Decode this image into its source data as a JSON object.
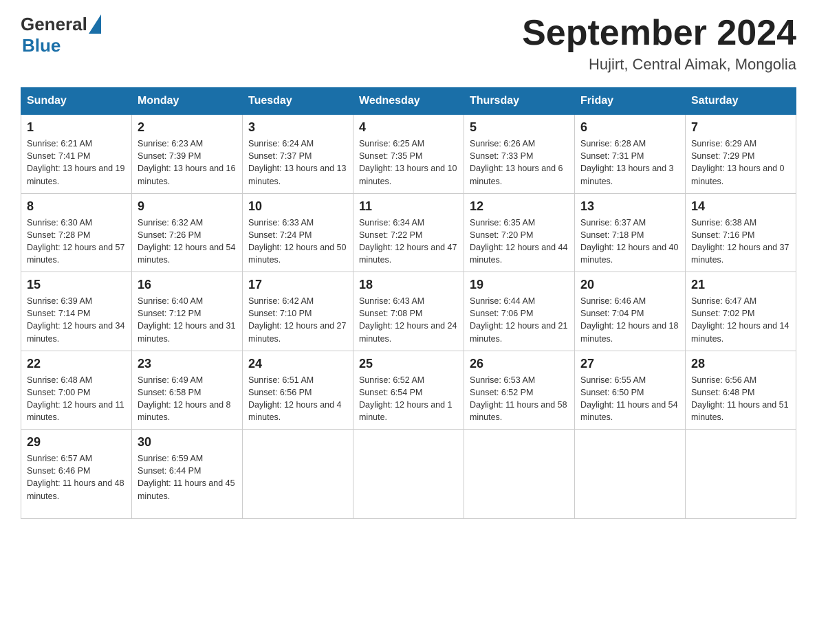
{
  "header": {
    "title": "September 2024",
    "location": "Hujirt, Central Aimak, Mongolia",
    "logo_general": "General",
    "logo_blue": "Blue"
  },
  "days_of_week": [
    "Sunday",
    "Monday",
    "Tuesday",
    "Wednesday",
    "Thursday",
    "Friday",
    "Saturday"
  ],
  "weeks": [
    [
      {
        "day": "1",
        "sunrise": "6:21 AM",
        "sunset": "7:41 PM",
        "daylight": "13 hours and 19 minutes."
      },
      {
        "day": "2",
        "sunrise": "6:23 AM",
        "sunset": "7:39 PM",
        "daylight": "13 hours and 16 minutes."
      },
      {
        "day": "3",
        "sunrise": "6:24 AM",
        "sunset": "7:37 PM",
        "daylight": "13 hours and 13 minutes."
      },
      {
        "day": "4",
        "sunrise": "6:25 AM",
        "sunset": "7:35 PM",
        "daylight": "13 hours and 10 minutes."
      },
      {
        "day": "5",
        "sunrise": "6:26 AM",
        "sunset": "7:33 PM",
        "daylight": "13 hours and 6 minutes."
      },
      {
        "day": "6",
        "sunrise": "6:28 AM",
        "sunset": "7:31 PM",
        "daylight": "13 hours and 3 minutes."
      },
      {
        "day": "7",
        "sunrise": "6:29 AM",
        "sunset": "7:29 PM",
        "daylight": "13 hours and 0 minutes."
      }
    ],
    [
      {
        "day": "8",
        "sunrise": "6:30 AM",
        "sunset": "7:28 PM",
        "daylight": "12 hours and 57 minutes."
      },
      {
        "day": "9",
        "sunrise": "6:32 AM",
        "sunset": "7:26 PM",
        "daylight": "12 hours and 54 minutes."
      },
      {
        "day": "10",
        "sunrise": "6:33 AM",
        "sunset": "7:24 PM",
        "daylight": "12 hours and 50 minutes."
      },
      {
        "day": "11",
        "sunrise": "6:34 AM",
        "sunset": "7:22 PM",
        "daylight": "12 hours and 47 minutes."
      },
      {
        "day": "12",
        "sunrise": "6:35 AM",
        "sunset": "7:20 PM",
        "daylight": "12 hours and 44 minutes."
      },
      {
        "day": "13",
        "sunrise": "6:37 AM",
        "sunset": "7:18 PM",
        "daylight": "12 hours and 40 minutes."
      },
      {
        "day": "14",
        "sunrise": "6:38 AM",
        "sunset": "7:16 PM",
        "daylight": "12 hours and 37 minutes."
      }
    ],
    [
      {
        "day": "15",
        "sunrise": "6:39 AM",
        "sunset": "7:14 PM",
        "daylight": "12 hours and 34 minutes."
      },
      {
        "day": "16",
        "sunrise": "6:40 AM",
        "sunset": "7:12 PM",
        "daylight": "12 hours and 31 minutes."
      },
      {
        "day": "17",
        "sunrise": "6:42 AM",
        "sunset": "7:10 PM",
        "daylight": "12 hours and 27 minutes."
      },
      {
        "day": "18",
        "sunrise": "6:43 AM",
        "sunset": "7:08 PM",
        "daylight": "12 hours and 24 minutes."
      },
      {
        "day": "19",
        "sunrise": "6:44 AM",
        "sunset": "7:06 PM",
        "daylight": "12 hours and 21 minutes."
      },
      {
        "day": "20",
        "sunrise": "6:46 AM",
        "sunset": "7:04 PM",
        "daylight": "12 hours and 18 minutes."
      },
      {
        "day": "21",
        "sunrise": "6:47 AM",
        "sunset": "7:02 PM",
        "daylight": "12 hours and 14 minutes."
      }
    ],
    [
      {
        "day": "22",
        "sunrise": "6:48 AM",
        "sunset": "7:00 PM",
        "daylight": "12 hours and 11 minutes."
      },
      {
        "day": "23",
        "sunrise": "6:49 AM",
        "sunset": "6:58 PM",
        "daylight": "12 hours and 8 minutes."
      },
      {
        "day": "24",
        "sunrise": "6:51 AM",
        "sunset": "6:56 PM",
        "daylight": "12 hours and 4 minutes."
      },
      {
        "day": "25",
        "sunrise": "6:52 AM",
        "sunset": "6:54 PM",
        "daylight": "12 hours and 1 minute."
      },
      {
        "day": "26",
        "sunrise": "6:53 AM",
        "sunset": "6:52 PM",
        "daylight": "11 hours and 58 minutes."
      },
      {
        "day": "27",
        "sunrise": "6:55 AM",
        "sunset": "6:50 PM",
        "daylight": "11 hours and 54 minutes."
      },
      {
        "day": "28",
        "sunrise": "6:56 AM",
        "sunset": "6:48 PM",
        "daylight": "11 hours and 51 minutes."
      }
    ],
    [
      {
        "day": "29",
        "sunrise": "6:57 AM",
        "sunset": "6:46 PM",
        "daylight": "11 hours and 48 minutes."
      },
      {
        "day": "30",
        "sunrise": "6:59 AM",
        "sunset": "6:44 PM",
        "daylight": "11 hours and 45 minutes."
      },
      {
        "day": "",
        "sunrise": "",
        "sunset": "",
        "daylight": ""
      },
      {
        "day": "",
        "sunrise": "",
        "sunset": "",
        "daylight": ""
      },
      {
        "day": "",
        "sunrise": "",
        "sunset": "",
        "daylight": ""
      },
      {
        "day": "",
        "sunrise": "",
        "sunset": "",
        "daylight": ""
      },
      {
        "day": "",
        "sunrise": "",
        "sunset": "",
        "daylight": ""
      }
    ]
  ]
}
